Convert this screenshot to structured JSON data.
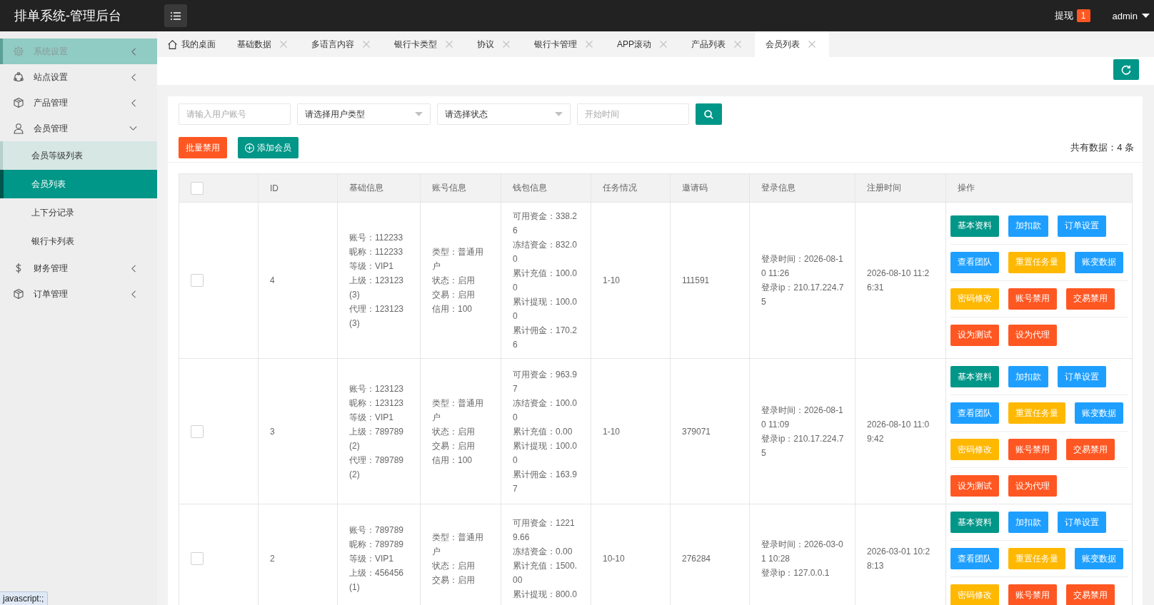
{
  "header": {
    "title": "排单系统-管理后台",
    "withdraw": {
      "label": "提现",
      "badge": "1"
    },
    "user": "admin"
  },
  "sidebar": {
    "items": [
      {
        "label": "系统设置",
        "highlighted": true,
        "selected": false,
        "expanded": false
      },
      {
        "label": "站点设置",
        "highlighted": false,
        "selected": false,
        "expanded": false
      },
      {
        "label": "产品管理",
        "highlighted": false,
        "selected": false,
        "expanded": false
      },
      {
        "label": "会员管理",
        "highlighted": false,
        "selected": false,
        "expanded": true,
        "children": [
          {
            "label": "会员等级列表",
            "highlighted": true,
            "selected": false
          },
          {
            "label": "会员列表",
            "highlighted": false,
            "selected": true
          },
          {
            "label": "上下分记录",
            "highlighted": false,
            "selected": false
          },
          {
            "label": "银行卡列表",
            "highlighted": false,
            "selected": false
          }
        ]
      },
      {
        "label": "财务管理",
        "highlighted": false,
        "selected": false,
        "expanded": false
      },
      {
        "label": "订单管理",
        "highlighted": false,
        "selected": false,
        "expanded": false
      }
    ]
  },
  "tabs": [
    {
      "label": "我的桌面",
      "kind": "home",
      "selected": false
    },
    {
      "label": "基础数据",
      "kind": "page",
      "selected": false
    },
    {
      "label": "多语言内容",
      "kind": "page",
      "selected": false
    },
    {
      "label": "银行卡类型",
      "kind": "page",
      "selected": false
    },
    {
      "label": "协议",
      "kind": "page",
      "selected": false
    },
    {
      "label": "银行卡管理",
      "kind": "page",
      "selected": false
    },
    {
      "label": "APP滚动",
      "kind": "page",
      "selected": false
    },
    {
      "label": "产品列表",
      "kind": "page",
      "selected": false
    },
    {
      "label": "会员列表",
      "kind": "page",
      "selected": true
    }
  ],
  "filters": [
    {
      "kind": "input",
      "placeholder": "请输入用户账号"
    },
    {
      "kind": "select",
      "value": "请选择用户类型"
    },
    {
      "kind": "select",
      "value": "请选择状态"
    },
    {
      "kind": "input",
      "placeholder": "开始时间"
    }
  ],
  "toolbar": {
    "buttons": [
      {
        "label": "批量禁用",
        "kind": "danger"
      },
      {
        "label": "添加会员",
        "kind": "add"
      }
    ],
    "total": "共有数据：4 条"
  },
  "table": {
    "all_checked": false,
    "columns": [
      "ID",
      "基础信息",
      "账号信息",
      "钱包信息",
      "任务情况",
      "邀请码",
      "登录信息",
      "注册时间",
      "操作"
    ],
    "rows": [
      {
        "checked": false,
        "id": "4",
        "basic": [
          "账号：112233",
          "昵称：112233",
          "等级：VIP1",
          "上级：123123(3)",
          "代理：123123(3)"
        ],
        "account": [
          "类型：普通用户",
          "状态：启用",
          "交易：启用",
          "信用：100"
        ],
        "wallet": [
          "可用资金：338.26",
          "冻结资金：832.00",
          "累计充值：100.00",
          "累计提现：100.00",
          "累计佣金：170.26"
        ],
        "task": "1-10",
        "invite_code": "111591",
        "login": [
          "登录时间：2026-08-10 11:26",
          "登录ip：210.17.224.75"
        ],
        "registered": "2026-08-10 11:26:31",
        "action_rows": [
          [
            {
              "label": "基本资料",
              "kind": "default"
            },
            {
              "label": "加扣款",
              "kind": "normal"
            },
            {
              "label": "订单设置",
              "kind": "normal"
            }
          ],
          [
            {
              "label": "查看团队",
              "kind": "normal"
            },
            {
              "label": "重置任务量",
              "kind": "warm"
            },
            {
              "label": "账变数据",
              "kind": "normal"
            }
          ],
          [
            {
              "label": "密码修改",
              "kind": "warm"
            },
            {
              "label": "账号禁用",
              "kind": "danger"
            },
            {
              "label": "交易禁用",
              "kind": "danger"
            }
          ],
          [
            {
              "label": "设为测试",
              "kind": "danger"
            },
            {
              "label": "设为代理",
              "kind": "danger"
            }
          ]
        ]
      },
      {
        "checked": false,
        "id": "3",
        "basic": [
          "账号：123123",
          "昵称：123123",
          "等级：VIP1",
          "上级：789789(2)",
          "代理：789789(2)"
        ],
        "account": [
          "类型：普通用户",
          "状态：启用",
          "交易：启用",
          "信用：100"
        ],
        "wallet": [
          "可用资金：963.97",
          "冻结资金：100.00",
          "累计充值：0.00",
          "累计提现：100.00",
          "累计佣金：163.97"
        ],
        "task": "1-10",
        "invite_code": "379071",
        "login": [
          "登录时间：2026-08-10 11:09",
          "登录ip：210.17.224.75"
        ],
        "registered": "2026-08-10 11:09:42",
        "action_rows": [
          [
            {
              "label": "基本资料",
              "kind": "default"
            },
            {
              "label": "加扣款",
              "kind": "normal"
            },
            {
              "label": "订单设置",
              "kind": "normal"
            }
          ],
          [
            {
              "label": "查看团队",
              "kind": "normal"
            },
            {
              "label": "重置任务量",
              "kind": "warm"
            },
            {
              "label": "账变数据",
              "kind": "normal"
            }
          ],
          [
            {
              "label": "密码修改",
              "kind": "warm"
            },
            {
              "label": "账号禁用",
              "kind": "danger"
            },
            {
              "label": "交易禁用",
              "kind": "danger"
            }
          ],
          [
            {
              "label": "设为测试",
              "kind": "danger"
            },
            {
              "label": "设为代理",
              "kind": "danger"
            }
          ]
        ]
      },
      {
        "checked": false,
        "id": "2",
        "basic": [
          "账号：789789",
          "昵称：789789",
          "等级：VIP1",
          "上级：456456(1)"
        ],
        "account": [
          "类型：普通用户",
          "状态：启用",
          "交易：启用"
        ],
        "wallet": [
          "可用资金：12219.66",
          "冻结资金：0.00",
          "累计充值：1500.00",
          "累计提现：800.0"
        ],
        "task": "10-10",
        "invite_code": "276284",
        "login": [
          "登录时间：2026-03-01 10:28",
          "登录ip：127.0.0.1"
        ],
        "registered": "2026-03-01 10:28:13",
        "action_rows": [
          [
            {
              "label": "基本资料",
              "kind": "default"
            },
            {
              "label": "加扣款",
              "kind": "normal"
            },
            {
              "label": "订单设置",
              "kind": "normal"
            }
          ],
          [
            {
              "label": "查看团队",
              "kind": "normal"
            },
            {
              "label": "重置任务量",
              "kind": "warm"
            },
            {
              "label": "账变数据",
              "kind": "normal"
            }
          ],
          [
            {
              "label": "密码修改",
              "kind": "warm"
            },
            {
              "label": "账号禁用",
              "kind": "danger"
            },
            {
              "label": "交易禁用",
              "kind": "danger"
            }
          ]
        ]
      }
    ]
  },
  "status_bar": {
    "text": "javascript:;"
  }
}
